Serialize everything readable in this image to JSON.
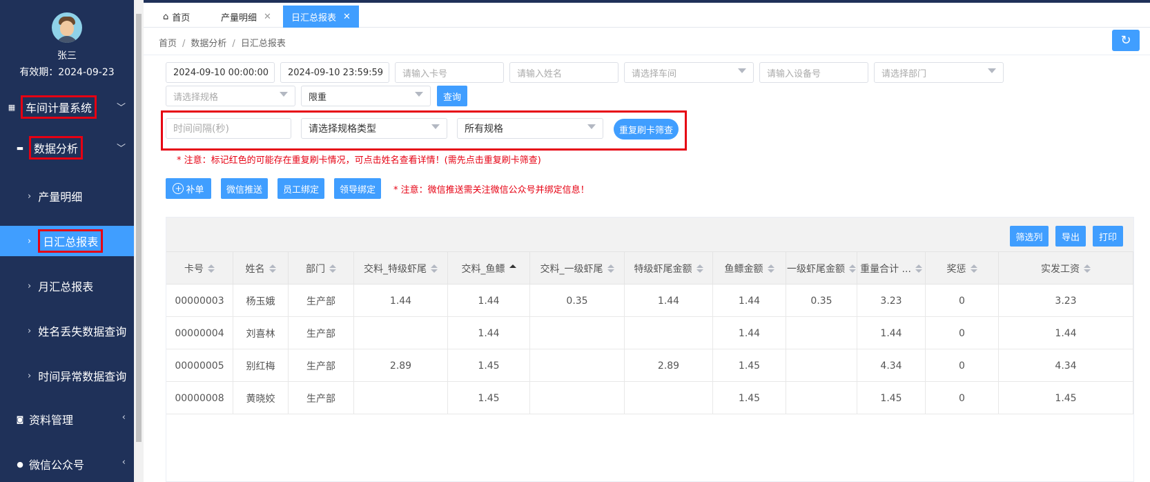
{
  "user": {
    "name": "张三",
    "valid_until": "有效期：2024-09-23"
  },
  "sidebar": {
    "groups": [
      {
        "label": "车间计量系统"
      },
      {
        "label": "数据分析"
      }
    ],
    "sub_items": [
      {
        "label": "产量明细"
      },
      {
        "label": "日汇总报表"
      },
      {
        "label": "月汇总报表"
      },
      {
        "label": "姓名丢失数据查询"
      },
      {
        "label": "时间异常数据查询"
      }
    ],
    "more_groups": [
      {
        "label": "资料管理"
      },
      {
        "label": "微信公众号"
      }
    ]
  },
  "tabs": [
    {
      "label": "首页"
    },
    {
      "label": "产量明细"
    },
    {
      "label": "日汇总报表"
    }
  ],
  "breadcrumb": [
    "首页",
    "数据分析",
    "日汇总报表"
  ],
  "filters": {
    "start_time": "2024-09-10 00:00:00",
    "end_time": "2024-09-10 23:59:59",
    "card_placeholder": "请输入卡号",
    "name_placeholder": "请输入姓名",
    "workshop_placeholder": "请选择车间",
    "device_placeholder": "请输入设备号",
    "dept_placeholder": "请选择部门",
    "spec_placeholder": "请选择规格",
    "weight_select": "限重",
    "query_label": "查询",
    "interval_placeholder": "时间间隔(秒)",
    "spec_type_select": "请选择规格类型",
    "all_spec_select": "所有规格",
    "dup_button": "重复刷卡筛查"
  },
  "notes": {
    "dup_note": "* 注意：标记红色的可能存在重复刷卡情况，可点击姓名查看详情！(需先点击重复刷卡筛查)",
    "wechat_note": "* 注意：微信推送需关注微信公众号并绑定信息！"
  },
  "actions": {
    "add": "补单",
    "wechat": "微信推送",
    "staff_bind": "员工绑定",
    "leader_bind": "领导绑定"
  },
  "table_toolbar": {
    "filter_cols": "筛选列",
    "export": "导出",
    "print": "打印"
  },
  "table": {
    "columns": [
      "卡号",
      "姓名",
      "部门",
      "交料_特级虾尾",
      "交料_鱼鳔",
      "交料_一级虾尾",
      "特级虾尾金额",
      "鱼鳔金额",
      "一级虾尾金额",
      "重量合计 ...",
      "奖惩",
      "实发工资"
    ],
    "rows": [
      [
        "00000003",
        "杨玉娥",
        "生产部",
        "1.44",
        "1.44",
        "0.35",
        "1.44",
        "1.44",
        "0.35",
        "3.23",
        "0",
        "3.23"
      ],
      [
        "00000004",
        "刘喜林",
        "生产部",
        "",
        "1.44",
        "",
        "",
        "1.44",
        "",
        "1.44",
        "0",
        "1.44"
      ],
      [
        "00000005",
        "别红梅",
        "生产部",
        "2.89",
        "1.45",
        "",
        "2.89",
        "1.45",
        "",
        "4.34",
        "0",
        "4.34"
      ],
      [
        "00000008",
        "黄晓姣",
        "生产部",
        "",
        "1.45",
        "",
        "",
        "1.45",
        "",
        "1.45",
        "0",
        "1.45"
      ]
    ]
  },
  "colors": {
    "sidebar_bg": "#1f3159",
    "accent": "#409eff",
    "alert_red": "#e60012"
  }
}
